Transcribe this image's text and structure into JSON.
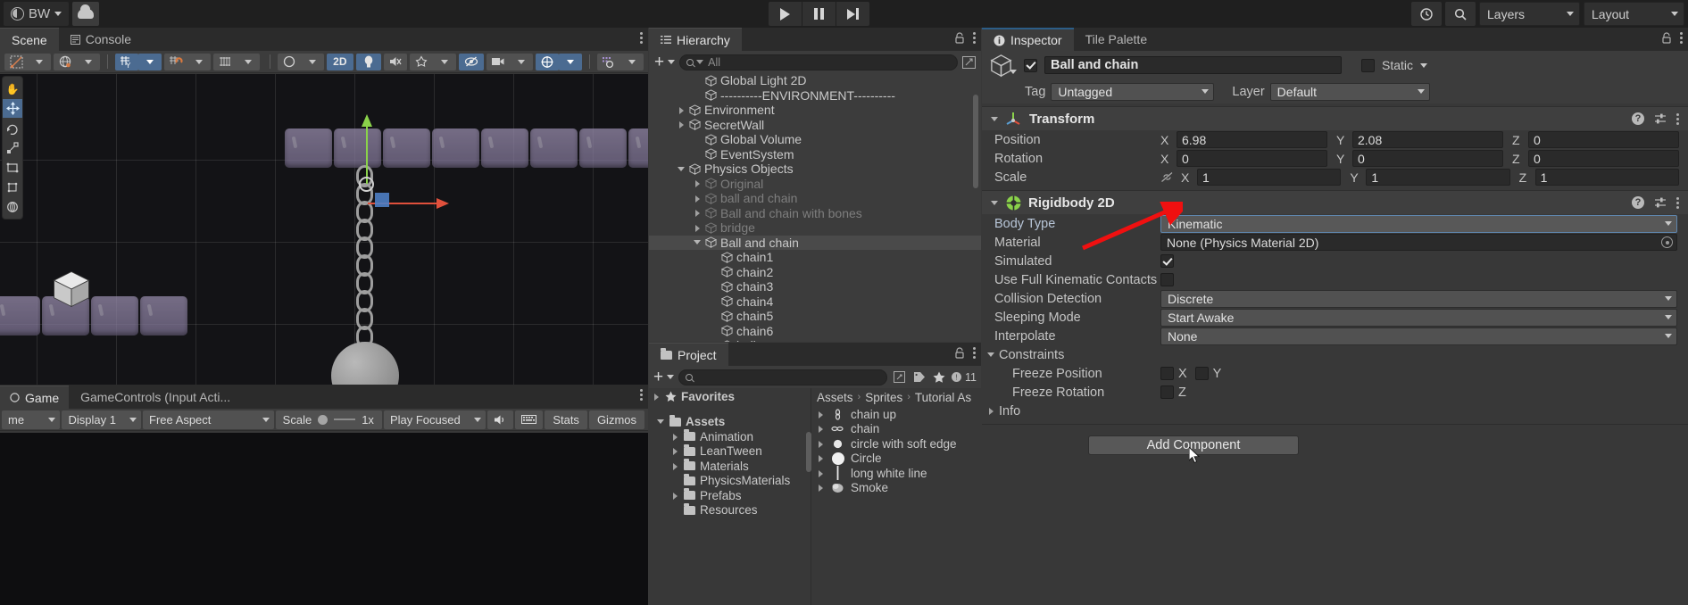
{
  "topbar": {
    "account_label": "BW",
    "cloud_icon": "cloud-icon",
    "play_icon": "play-icon",
    "pause_icon": "pause-icon",
    "step_icon": "step-icon",
    "history_icon": "history-icon",
    "search_icon": "search-icon",
    "layers_label": "Layers",
    "layout_label": "Layout"
  },
  "scene": {
    "tabs": [
      {
        "label": "Scene",
        "icon": "scene-icon",
        "active": true
      },
      {
        "label": "Console",
        "icon": "console-icon",
        "active": false
      }
    ],
    "toolbar": {
      "tool_icon": "draw-tool-icon",
      "pivot_icon": "global-pivot-icon",
      "grid_icon": "grid-axis-y-icon",
      "snap_icon": "grid-snapping-icon",
      "ruler_icon": "grid-size-icon",
      "shading_icon": "shading-mode-icon",
      "mode_2d_label": "2D",
      "light_icon": "lighting-icon",
      "audio_icon": "audio-mute-icon",
      "fx_icon": "effects-icon",
      "hidden_icon": "hidden-objects-icon",
      "camera_icon": "scene-camera-icon",
      "gizmo_icon": "gizmos-toggle-icon",
      "gizmo_vis_icon": "gizmo-visibility-icon"
    },
    "tools": [
      {
        "icon": "hand-tool-icon",
        "active": false
      },
      {
        "icon": "move-tool-icon",
        "active": true
      },
      {
        "icon": "rotate-tool-icon",
        "active": false
      },
      {
        "icon": "scale-tool-icon",
        "active": false
      },
      {
        "icon": "rect-tool-icon",
        "active": false
      },
      {
        "icon": "transform-tool-icon",
        "active": false
      },
      {
        "icon": "custom-tool-icon",
        "active": false
      }
    ]
  },
  "game": {
    "tabs": [
      {
        "label": "Game",
        "icon": "game-icon",
        "active": true
      },
      {
        "label": "GameControls (Input Acti...",
        "icon": "input-actions-icon",
        "active": false
      }
    ],
    "toolbar": {
      "mode_label": "me",
      "display_label": "Display 1",
      "aspect_label": "Free Aspect",
      "scale_label": "Scale",
      "scale_value": "1x",
      "play_mode_label": "Play Focused",
      "mute_icon": "mute-audio-icon",
      "keyboard_icon": "keyboard-input-icon",
      "stats_label": "Stats",
      "gizmos_label": "Gizmos"
    }
  },
  "hierarchy": {
    "tab_label": "Hierarchy",
    "tab_icon": "hierarchy-icon",
    "add_label": "+",
    "search_placeholder": "All",
    "items": [
      {
        "label": "Global Light 2D",
        "depth": 2,
        "arrow": "none",
        "dim": false,
        "selected": false
      },
      {
        "label": "----------ENVIRONMENT----------",
        "depth": 2,
        "arrow": "none",
        "dim": false,
        "selected": false
      },
      {
        "label": "Environment",
        "depth": 1,
        "arrow": "right",
        "dim": false,
        "selected": false
      },
      {
        "label": "SecretWall",
        "depth": 1,
        "arrow": "right",
        "dim": false,
        "selected": false
      },
      {
        "label": "Global Volume",
        "depth": 2,
        "arrow": "none",
        "dim": false,
        "selected": false
      },
      {
        "label": "EventSystem",
        "depth": 2,
        "arrow": "none",
        "dim": false,
        "selected": false
      },
      {
        "label": "Physics Objects",
        "depth": 1,
        "arrow": "down",
        "dim": false,
        "selected": false
      },
      {
        "label": "Original",
        "depth": 2,
        "arrow": "right",
        "dim": true,
        "selected": false
      },
      {
        "label": "ball and chain",
        "depth": 2,
        "arrow": "right",
        "dim": true,
        "selected": false
      },
      {
        "label": "Ball and chain with bones",
        "depth": 2,
        "arrow": "right",
        "dim": true,
        "selected": false
      },
      {
        "label": "bridge",
        "depth": 2,
        "arrow": "right",
        "dim": true,
        "selected": false
      },
      {
        "label": "Ball and chain",
        "depth": 2,
        "arrow": "down",
        "dim": false,
        "selected": true
      },
      {
        "label": "chain1",
        "depth": 3,
        "arrow": "none",
        "dim": false,
        "selected": false
      },
      {
        "label": "chain2",
        "depth": 3,
        "arrow": "none",
        "dim": false,
        "selected": false
      },
      {
        "label": "chain3",
        "depth": 3,
        "arrow": "none",
        "dim": false,
        "selected": false
      },
      {
        "label": "chain4",
        "depth": 3,
        "arrow": "none",
        "dim": false,
        "selected": false
      },
      {
        "label": "chain5",
        "depth": 3,
        "arrow": "none",
        "dim": false,
        "selected": false
      },
      {
        "label": "chain6",
        "depth": 3,
        "arrow": "none",
        "dim": false,
        "selected": false
      },
      {
        "label": "ball",
        "depth": 3,
        "arrow": "none",
        "dim": false,
        "selected": false
      }
    ]
  },
  "project": {
    "tab_label": "Project",
    "tab_icon": "project-folder-icon",
    "add_label": "+",
    "search_placeholder": "",
    "badge_count": "11",
    "icons": [
      "lock-icon",
      "tag-icon",
      "favorite-star-icon",
      "error-count-icon"
    ],
    "favorites_label": "Favorites",
    "tree": [
      {
        "label": "Assets",
        "depth": 0,
        "arrow": "down",
        "bold": true
      },
      {
        "label": "Animation",
        "depth": 1,
        "arrow": "right",
        "bold": false
      },
      {
        "label": "LeanTween",
        "depth": 1,
        "arrow": "right",
        "bold": false
      },
      {
        "label": "Materials",
        "depth": 1,
        "arrow": "right",
        "bold": false
      },
      {
        "label": "PhysicsMaterials",
        "depth": 1,
        "arrow": "none",
        "bold": false
      },
      {
        "label": "Prefabs",
        "depth": 1,
        "arrow": "right",
        "bold": false
      },
      {
        "label": "Resources",
        "depth": 1,
        "arrow": "none",
        "bold": false
      }
    ],
    "breadcrumb": [
      "Assets",
      "Sprites",
      "Tutorial As"
    ],
    "assets": [
      {
        "label": "chain up",
        "icon": "sprite-chain-up-icon"
      },
      {
        "label": "chain",
        "icon": "sprite-chain-icon"
      },
      {
        "label": "circle with soft edge",
        "icon": "sprite-soft-circle-icon"
      },
      {
        "label": "Circle",
        "icon": "sprite-circle-icon"
      },
      {
        "label": "long white line",
        "icon": "sprite-line-icon"
      },
      {
        "label": "Smoke",
        "icon": "sprite-smoke-icon"
      }
    ]
  },
  "inspector": {
    "tabs": [
      {
        "label": "Inspector",
        "icon": "info-icon",
        "active": true
      },
      {
        "label": "Tile Palette",
        "icon": "tile-palette-icon",
        "active": false
      }
    ],
    "object": {
      "enabled": true,
      "name": "Ball and chain",
      "static_label": "Static",
      "tag_label": "Tag",
      "tag_value": "Untagged",
      "layer_label": "Layer",
      "layer_value": "Default"
    },
    "transform": {
      "title": "Transform",
      "icon": "transform-icon",
      "rows": [
        {
          "label": "Position",
          "x": "6.98",
          "y": "2.08",
          "z": "0",
          "has_link": false
        },
        {
          "label": "Rotation",
          "x": "0",
          "y": "0",
          "z": "0",
          "has_link": false
        },
        {
          "label": "Scale",
          "x": "1",
          "y": "1",
          "z": "1",
          "has_link": true
        }
      ]
    },
    "rigidbody": {
      "title": "Rigidbody 2D",
      "icon": "rigidbody2d-icon",
      "body_type_label": "Body Type",
      "body_type_value": "Kinematic",
      "material_label": "Material",
      "material_value": "None (Physics Material 2D)",
      "simulated_label": "Simulated",
      "simulated_checked": true,
      "kinematic_contacts_label": "Use Full Kinematic Contacts",
      "kinematic_contacts_checked": false,
      "collision_detection_label": "Collision Detection",
      "collision_detection_value": "Discrete",
      "sleeping_mode_label": "Sleeping Mode",
      "sleeping_mode_value": "Start Awake",
      "interpolate_label": "Interpolate",
      "interpolate_value": "None",
      "constraints_label": "Constraints",
      "freeze_position_label": "Freeze Position",
      "freeze_position_x": "X",
      "freeze_position_y": "Y",
      "freeze_rotation_label": "Freeze Rotation",
      "freeze_rotation_z": "Z",
      "info_label": "Info"
    },
    "add_component_label": "Add Component",
    "annotation_arrow_color": "#f01010"
  }
}
